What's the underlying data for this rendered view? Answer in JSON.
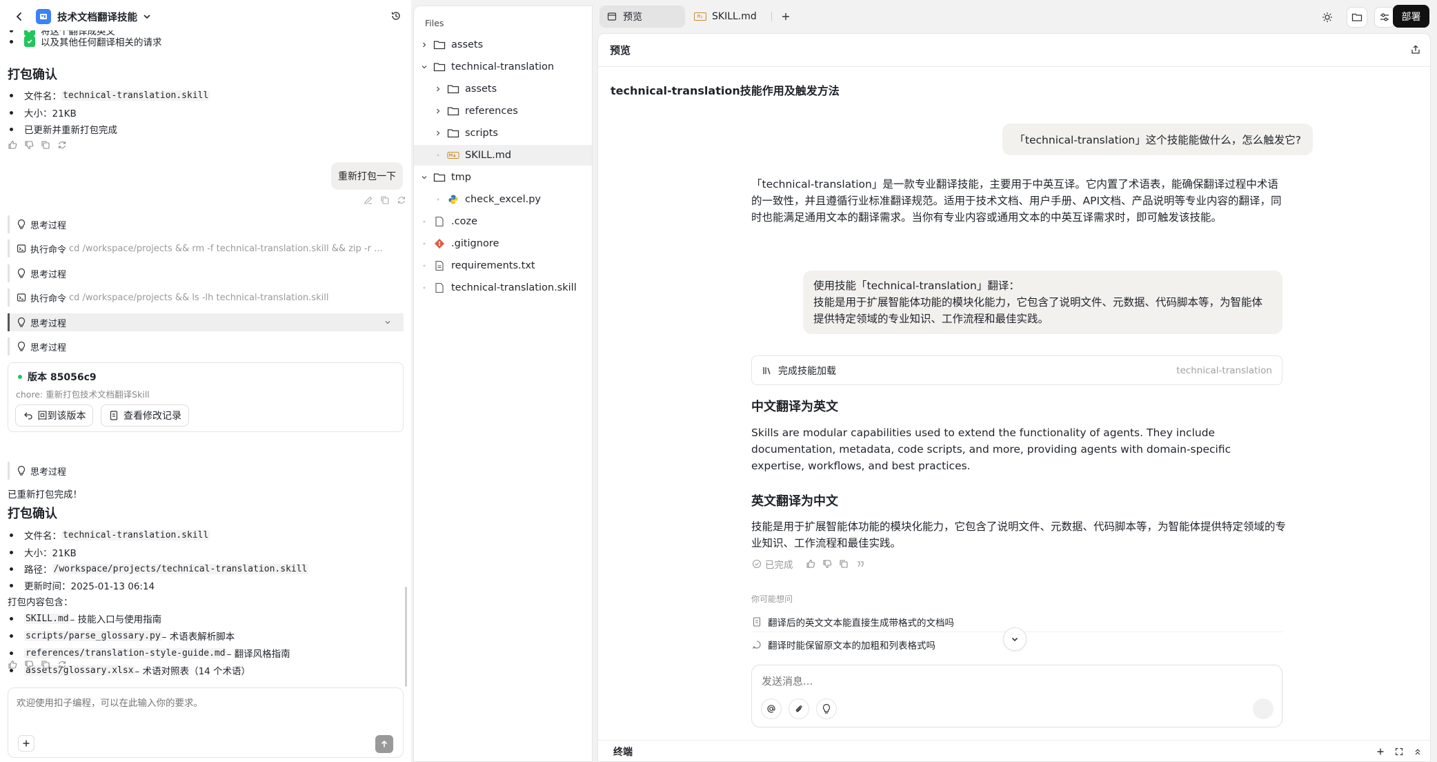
{
  "left": {
    "title": "技术文档翻译技能",
    "partial_line": "将这个翻译成英文",
    "check_item": "以及其他任何翻译相关的请求",
    "confirm1": {
      "heading": "打包确认",
      "filename_label": "文件名：",
      "filename": "technical-translation.skill",
      "size": "大小：21KB",
      "done": "已更新并重新打包完成"
    },
    "user_bubble": "重新打包一下",
    "steps": [
      {
        "label": "思考过程"
      },
      {
        "label": "执行命令",
        "cmd": "cd /workspace/projects && rm -f technical-translation.skill && zip -r ..."
      },
      {
        "label": "思考过程"
      },
      {
        "label": "执行命令",
        "cmd": "cd /workspace/projects && ls -lh technical-translation.skill"
      },
      {
        "label": "思考过程"
      },
      {
        "label": "思考过程"
      }
    ],
    "version": {
      "title": "版本 85056c9",
      "message": "chore: 重新打包技术文档翻译Skill",
      "revert": "回到该版本",
      "view": "查看修改记录",
      "dot_color": "#22c55e"
    },
    "step_after": "思考过程",
    "done_msg": "已重新打包完成！",
    "confirm2": {
      "heading": "打包确认",
      "filename_label": "文件名：",
      "filename": "technical-translation.skill",
      "size": "大小：21KB",
      "path_label": "路径：",
      "path": "/workspace/projects/technical-translation.skill",
      "updated": "更新时间：2025-01-13 06:14",
      "contents_label": "打包内容包含：",
      "contents": [
        {
          "code": "SKILL.md",
          "desc": " – 技能入口与使用指南"
        },
        {
          "code": "scripts/parse_glossary.py",
          "desc": " – 术语表解析脚本"
        },
        {
          "code": "references/translation-style-guide.md",
          "desc": " – 翻译风格指南"
        },
        {
          "code": "assets/glossary.xlsx",
          "desc": " – 术语对照表（14 个术语）"
        }
      ]
    },
    "input_placeholder": "欢迎使用扣子编程，可以在此输入你的要求。"
  },
  "files": {
    "header": "Files",
    "tree": [
      {
        "name": "assets",
        "type": "folder",
        "depth": 0,
        "open": false
      },
      {
        "name": "technical-translation",
        "type": "folder",
        "depth": 0,
        "open": true
      },
      {
        "name": "assets",
        "type": "folder",
        "depth": 1,
        "open": false
      },
      {
        "name": "references",
        "type": "folder",
        "depth": 1,
        "open": false
      },
      {
        "name": "scripts",
        "type": "folder",
        "depth": 1,
        "open": false
      },
      {
        "name": "SKILL.md",
        "type": "md",
        "depth": 1,
        "selected": true
      },
      {
        "name": "tmp",
        "type": "folder",
        "depth": 0,
        "open": true
      },
      {
        "name": "check_excel.py",
        "type": "py",
        "depth": 1
      },
      {
        "name": ".coze",
        "type": "file",
        "depth": 0
      },
      {
        "name": ".gitignore",
        "type": "git",
        "depth": 0
      },
      {
        "name": "requirements.txt",
        "type": "txt",
        "depth": 0
      },
      {
        "name": "technical-translation.skill",
        "type": "file",
        "depth": 0
      }
    ]
  },
  "tabs": [
    {
      "label": "预览",
      "active": true
    },
    {
      "label": "SKILL.md",
      "active": false
    }
  ],
  "deploy": "部署",
  "preview": {
    "header": "预览",
    "title": "technical-translation技能作用及触发方法",
    "user_q": "「technical-translation」这个技能能做什么，怎么触发它?",
    "answer": "「technical-translation」是一款专业翻译技能，主要用于中英互译。它内置了术语表，能确保翻译过程中术语的一致性，并且遵循行业标准翻译规范。适用于技术文档、用户手册、API文档、产品说明等专业内容的翻译，同时也能满足通用文本的翻译需求。当你有专业内容或通用文本的中英互译需求时，即可触发该技能。",
    "user_req_1": "使用技能「technical-translation」翻译：",
    "user_req_2": "技能是用于扩展智能体功能的模块化能力，它包含了说明文件、元数据、代码脚本等，为智能体提供特定领域的专业知识、工作流程和最佳实践。",
    "skill_loaded": "完成技能加载",
    "skill_name": "technical-translation",
    "h_zh_en": "中文翻译为英文",
    "en_text": "Skills are modular capabilities used to extend the functionality of agents. They include documentation, metadata, code scripts, and more, providing agents with domain-specific expertise, workflows, and best practices.",
    "h_en_zh": "英文翻译为中文",
    "zh_text": "技能是用于扩展智能体功能的模块化能力，它包含了说明文件、元数据、代码脚本等，为智能体提供特定领域的专业知识、工作流程和最佳实践。",
    "completed": "已完成",
    "suggest_label": "你可能想问",
    "suggestions": [
      "翻译后的英文文本能直接生成带格式的文档吗",
      "翻译时能保留原文本的加粗和列表格式吗"
    ],
    "input_placeholder": "发送消息...",
    "terminal": "终端"
  }
}
